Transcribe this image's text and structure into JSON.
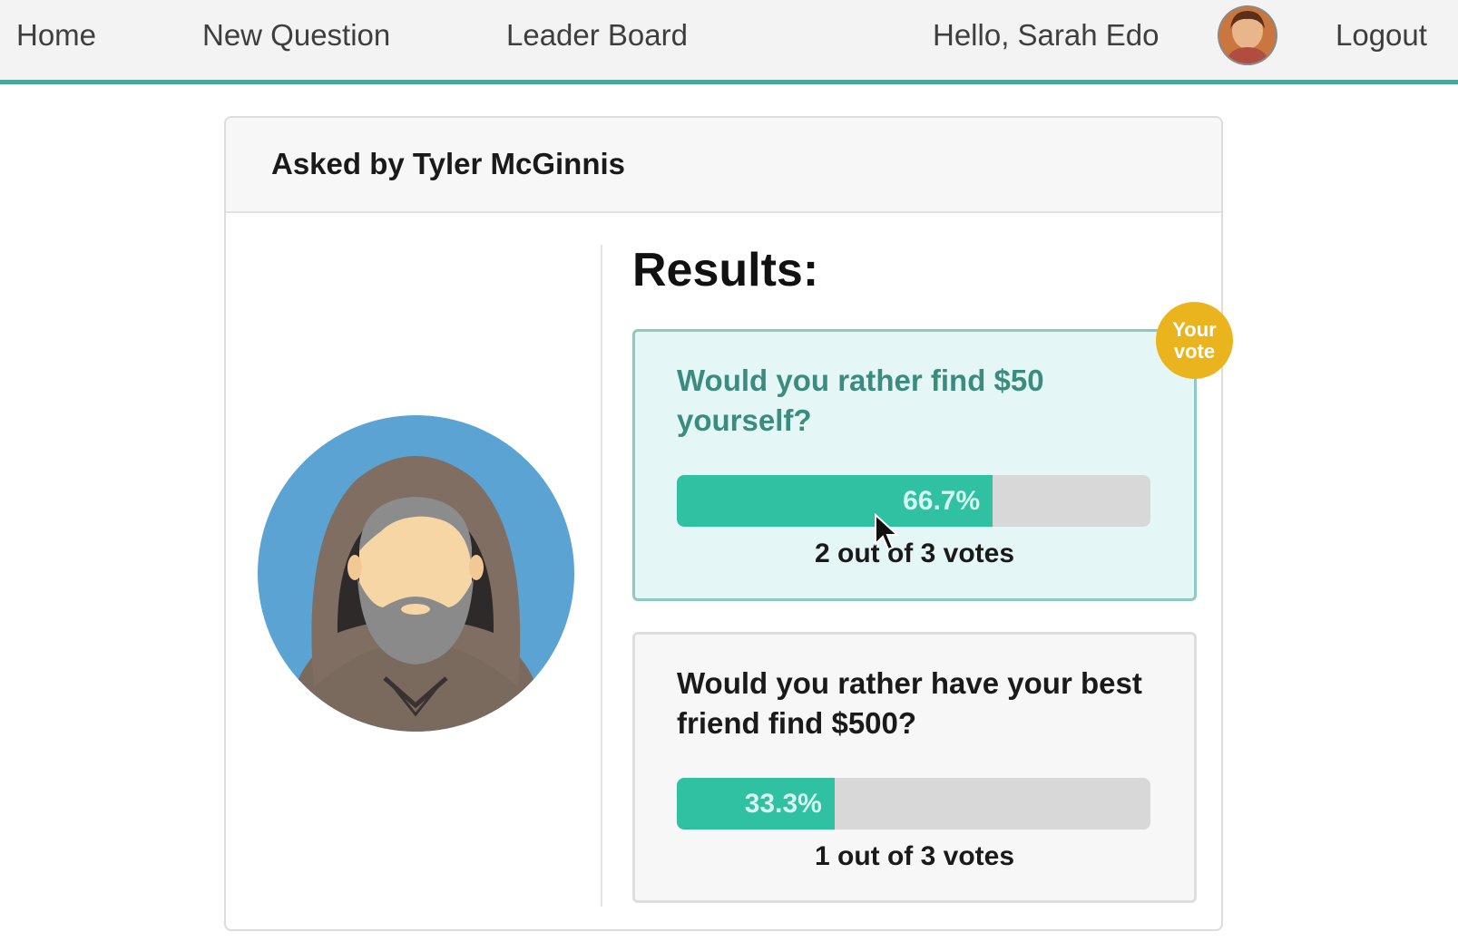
{
  "nav": {
    "home": "Home",
    "new_question": "New Question",
    "leader_board": "Leader Board",
    "greeting": "Hello, Sarah Edo",
    "logout": "Logout",
    "avatar_icon": "user-avatar-icon"
  },
  "question": {
    "asked_by": "Asked by Tyler McGinnis",
    "author_avatar_icon": "hooded-man-avatar-icon",
    "results_title": "Results:",
    "options": [
      {
        "text": "Would you rather find $50 yourself?",
        "percent_label": "66.7%",
        "percent": 66.7,
        "votes_text": "2 out of 3 votes",
        "your_vote": true
      },
      {
        "text": "Would you rather have your best friend find $500?",
        "percent_label": "33.3%",
        "percent": 33.3,
        "votes_text": "1 out of 3 votes",
        "your_vote": false
      }
    ],
    "your_vote_badge": {
      "line1": "Your",
      "line2": "vote"
    }
  },
  "colors": {
    "accent": "#4aa89a",
    "bar_fill": "#2fc1a1",
    "badge": "#e9b41e"
  }
}
